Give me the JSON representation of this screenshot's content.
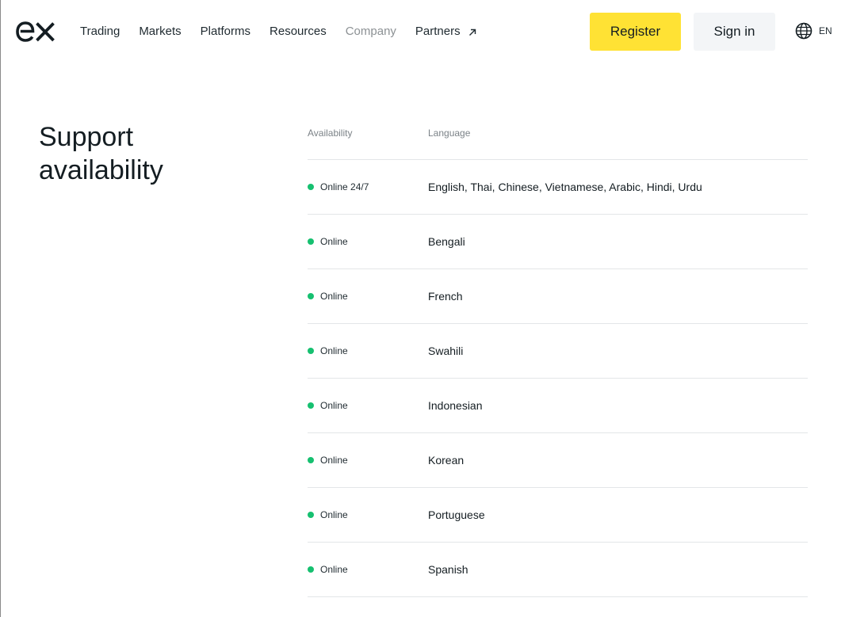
{
  "brand": {
    "logo_text": "ex",
    "accent_color": "#ffe234",
    "online_color": "#16c070"
  },
  "nav": {
    "items": [
      {
        "label": "Trading"
      },
      {
        "label": "Markets"
      },
      {
        "label": "Platforms"
      },
      {
        "label": "Resources"
      },
      {
        "label": "Company",
        "state": "active"
      },
      {
        "label": "Partners",
        "icon": "external-arrow-icon"
      }
    ]
  },
  "header": {
    "register_label": "Register",
    "signin_label": "Sign in",
    "language_code": "EN",
    "language_icon": "globe-icon"
  },
  "support": {
    "title": "Support availability",
    "columns": {
      "availability": "Availability",
      "language": "Language"
    },
    "rows": [
      {
        "availability": "Online 24/7",
        "language": "English, Thai, Chinese, Vietnamese, Arabic, Hindi, Urdu"
      },
      {
        "availability": "Online",
        "language": "Bengali"
      },
      {
        "availability": "Online",
        "language": "French"
      },
      {
        "availability": "Online",
        "language": "Swahili"
      },
      {
        "availability": "Online",
        "language": "Indonesian"
      },
      {
        "availability": "Online",
        "language": "Korean"
      },
      {
        "availability": "Online",
        "language": "Portuguese"
      },
      {
        "availability": "Online",
        "language": "Spanish"
      }
    ]
  }
}
